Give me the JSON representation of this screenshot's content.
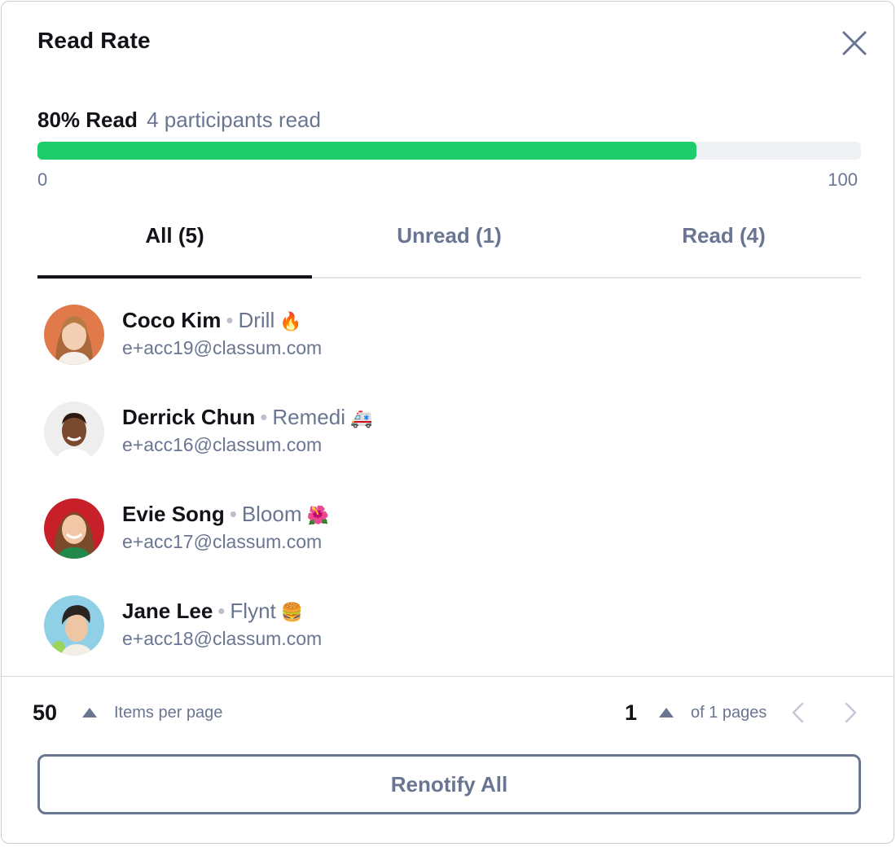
{
  "modal": {
    "title": "Read Rate"
  },
  "read_rate": {
    "percent_label": "80% Read",
    "summary": "4 participants read",
    "progress": 0.8,
    "scale_min": "0",
    "scale_max": "100",
    "fill_color": "#1fcc6b"
  },
  "tabs": [
    {
      "label": "All (5)",
      "active": true
    },
    {
      "label": "Unread (1)",
      "active": false
    },
    {
      "label": "Read (4)",
      "active": false
    }
  ],
  "participants": [
    {
      "name": "Coco Kim",
      "group": "Drill",
      "emoji": "🔥",
      "email": "e+acc19@classum.com"
    },
    {
      "name": "Derrick Chun",
      "group": "Remedi",
      "emoji": "🚑",
      "email": "e+acc16@classum.com"
    },
    {
      "name": "Evie Song",
      "group": "Bloom",
      "emoji": "🌺",
      "email": "e+acc17@classum.com"
    },
    {
      "name": "Jane Lee",
      "group": "Flynt",
      "emoji": "🍔",
      "email": "e+acc18@classum.com"
    }
  ],
  "separator": "•",
  "pagination": {
    "per_page": "50",
    "per_page_label": "Items per page",
    "page": "1",
    "page_label": "of 1 pages"
  },
  "actions": {
    "renotify_label": "Renotify All"
  },
  "icons": {
    "close": "close-icon",
    "caret": "caret-up-icon",
    "prev": "chevron-left-icon",
    "next": "chevron-right-icon"
  }
}
